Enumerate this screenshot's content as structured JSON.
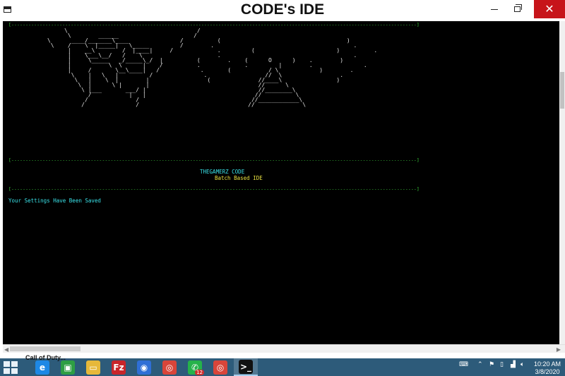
{
  "window": {
    "title": "CODE's IDE",
    "close_glyph": "✕"
  },
  "console": {
    "separator": "[-----------------------------------------------------------------------------------------------------------------------------------------------]",
    "ascii_art": [
      "                \\\\                                      /",
      "                 \\\\        ______                      /",
      "           \\\\      ____/_______\\\\____               /          (                                     )",
      "            \\\\    /    \\\\  |_____|   \\\\_____         /        .                                         .",
      "                 |    __\\\\        /  |____|     /             .         (                        )          .",
      "                 |    \\\\___\\\\__/   /    \\\\                      .                                       .",
      "                 |     \\\\_____   _/_____\\\\_/  |          (        .    (      O      )    .        )",
      "                 |           \\\\  \\\\      |    /          .             .         |        .               .",
      "                 |     /       \\\\__\\\\____|   /            .       (           / \\\\            )        .",
      "                  \\\\    |   \\\\   |         /               .                 //  \\\\                 .",
      "                   \\\\   |    \\\\  |        |                 (              //____\\\\                )",
      "                    \\\\  |      \\\\ |       |                                //      \\\\",
      "                     \\\\ |___       ___/ |                                 //________\\\\",
      "                       /           |   |                                //          \\\\",
      "                      /              /                                 //____________\\\\",
      "                     /               /                                //              \\\\"
    ],
    "brand_line": "THEGAMERZ CODE",
    "tagline": "Batch Based IDE",
    "status_message": "Your Settings Have Been Saved"
  },
  "taskbar": {
    "peek_text": "Call of Duty...",
    "apps": [
      {
        "name": "internet-explorer-icon",
        "glyph": "e",
        "color": "#1e88e5"
      },
      {
        "name": "store-icon",
        "glyph": "▣",
        "color": "#2e9e44"
      },
      {
        "name": "file-explorer-icon",
        "glyph": "▭",
        "color": "#e6b83a"
      },
      {
        "name": "filezilla-icon",
        "glyph": "Fz",
        "color": "#c7252a"
      },
      {
        "name": "firefox-icon",
        "glyph": "◉",
        "color": "#2f6fd6"
      },
      {
        "name": "chrome-icon",
        "glyph": "◎",
        "color": "#d8453a"
      },
      {
        "name": "whatsapp-icon",
        "glyph": "✆",
        "color": "#25b24a"
      },
      {
        "name": "chrome-profile-icon",
        "glyph": "◎",
        "color": "#d8453a"
      },
      {
        "name": "command-prompt-icon",
        "glyph": ">_",
        "color": "#111111"
      }
    ],
    "whatsapp_badge": "12",
    "time": "10:20 AM",
    "date": "3/8/2020"
  }
}
